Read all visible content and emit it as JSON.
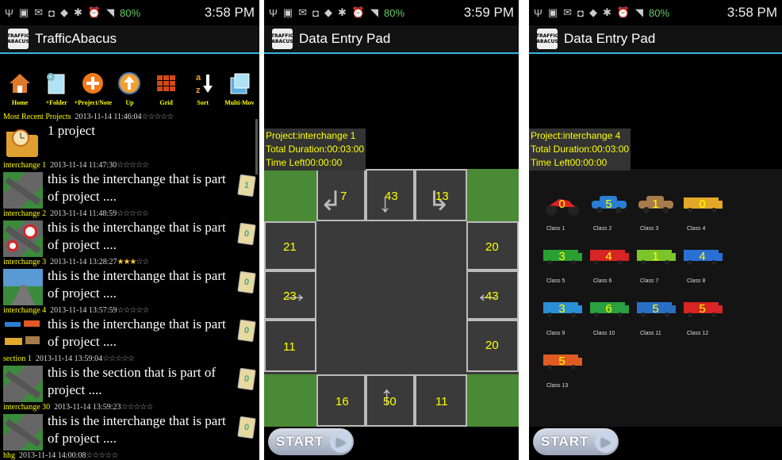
{
  "status": {
    "battery": "80%",
    "time1": "3:58 PM",
    "time2": "3:59 PM",
    "time3": "3:58 PM"
  },
  "logo_text": "TRAFFIC ABACUS",
  "panel1": {
    "title": "TrafficAbacus",
    "toolbar": [
      {
        "label": "Home",
        "icon": "home-icon"
      },
      {
        "label": "+Folder",
        "icon": "new-folder-icon"
      },
      {
        "label": "+Project/Note",
        "icon": "add-project-icon"
      },
      {
        "label": "Up",
        "icon": "up-arrow-icon"
      },
      {
        "label": "Grid",
        "icon": "grid-icon"
      },
      {
        "label": "Sort",
        "icon": "sort-az-icon"
      },
      {
        "label": "Multi-Mov",
        "icon": "multi-move-icon"
      }
    ],
    "items": [
      {
        "name": "Most Recent Projects",
        "date": "2013-11-14 11:46:04",
        "text": "1 project",
        "rating": 0
      },
      {
        "name": "interchange 1",
        "date": "2013-11-14 11:47:30",
        "text": "this is the interchange that is part of project ....",
        "rating": 0,
        "note": "1"
      },
      {
        "name": "interchange 2",
        "date": "2013-11-14 11:48:59",
        "text": "this is the interchange that is part of project ....",
        "rating": 0,
        "note": "0"
      },
      {
        "name": "interchange 3",
        "date": "2013-11-14 13:28:27",
        "text": "this is the interchange that is part of project ....",
        "rating": 3,
        "note": "0"
      },
      {
        "name": "interchange 4",
        "date": "2013-11-14 13:57:59",
        "text": "this is the interchange that is part of project ....",
        "rating": 0,
        "note": "0"
      },
      {
        "name": "section 1",
        "date": "2013-11-14 13:59:04",
        "text": "this is the section that is part of project ....",
        "rating": 0,
        "note": "0"
      },
      {
        "name": "interchange 30",
        "date": "2013-11-14 13:59:23",
        "text": "this is the interchange that is part of project ....",
        "rating": 0,
        "note": "0"
      },
      {
        "name": "hhg",
        "date": "2013-11-14 14:00:08",
        "text": "",
        "rating": 0
      }
    ]
  },
  "panel2": {
    "title": "Data Entry Pad",
    "project_label": "Project:",
    "project": "interchange 1",
    "duration_label": "Total Duration:",
    "duration": "00:03:00",
    "timeleft_label": "Time Left",
    "timeleft": "00:00:00",
    "counts": {
      "north": [
        "7",
        "43",
        "13"
      ],
      "east": [
        "20",
        "43",
        "20"
      ],
      "south": [
        "16",
        "50",
        "11"
      ],
      "west": [
        "21",
        "23",
        "11"
      ]
    },
    "start": "START"
  },
  "panel3": {
    "title": "Data Entry Pad",
    "project_label": "Project:",
    "project": "interchange 4",
    "duration_label": "Total Duration:",
    "duration": "00:03:00",
    "timeleft_label": "Time Left",
    "timeleft": "00:00:00",
    "classes": [
      {
        "label": "Class 1",
        "count": "0",
        "color": "#d22"
      },
      {
        "label": "Class 2",
        "count": "5",
        "color": "#2a7fd4"
      },
      {
        "label": "Class 3",
        "count": "1",
        "color": "#a87c4a"
      },
      {
        "label": "Class 4",
        "count": "0",
        "color": "#e3a82a"
      },
      {
        "label": "Class 5",
        "count": "3",
        "color": "#2aa032"
      },
      {
        "label": "Class 6",
        "count": "4",
        "color": "#d82424"
      },
      {
        "label": "Class 7",
        "count": "1",
        "color": "#7cc42a"
      },
      {
        "label": "Class 8",
        "count": "4",
        "color": "#2a6fd4"
      },
      {
        "label": "Class 9",
        "count": "3",
        "color": "#2a8fd4"
      },
      {
        "label": "Class 10",
        "count": "6",
        "color": "#2aa040"
      },
      {
        "label": "Class 11",
        "count": "5",
        "color": "#2a6fc4"
      },
      {
        "label": "Class 12",
        "count": "5",
        "color": "#d82424"
      },
      {
        "label": "Class 13",
        "count": "5",
        "color": "#e05a24"
      }
    ],
    "start": "START"
  }
}
